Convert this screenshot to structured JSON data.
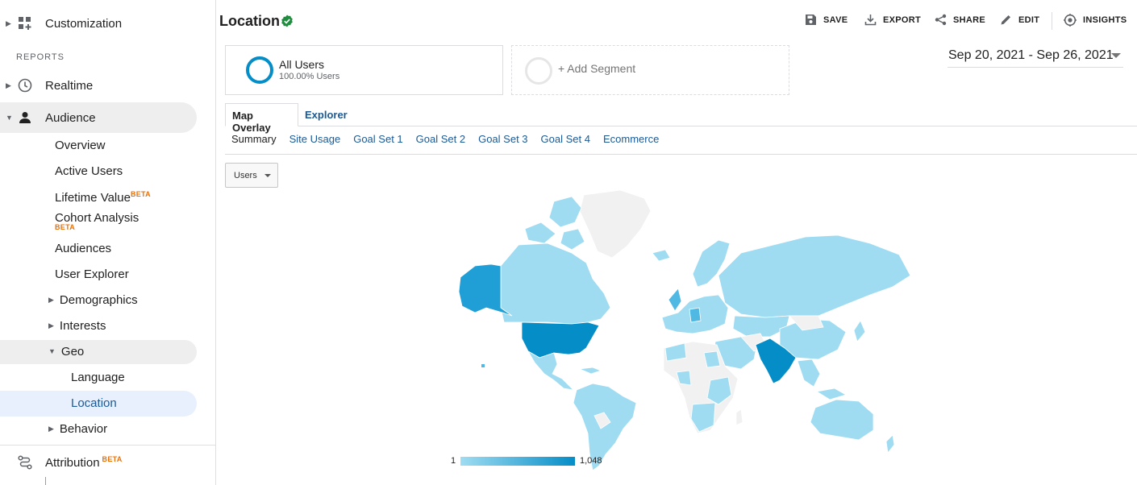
{
  "sidebar": {
    "customization": "Customization",
    "reports_header": "REPORTS",
    "realtime": "Realtime",
    "audience": "Audience",
    "audience_items": {
      "overview": "Overview",
      "active_users": "Active Users",
      "lifetime_value": "Lifetime Value",
      "cohort_analysis": "Cohort Analysis",
      "audiences": "Audiences",
      "user_explorer": "User Explorer",
      "demographics": "Demographics",
      "interests": "Interests",
      "geo": "Geo",
      "language": "Language",
      "location": "Location",
      "behavior": "Behavior"
    },
    "attribution": "Attribution",
    "beta_badge": "BETA"
  },
  "header": {
    "title": "Location",
    "actions": {
      "save": "SAVE",
      "export": "EXPORT",
      "share": "SHARE",
      "edit": "EDIT",
      "insights": "INSIGHTS"
    }
  },
  "segments": {
    "active": {
      "name": "All Users",
      "sub": "100.00% Users"
    },
    "add": "+ Add Segment"
  },
  "date_range": "Sep 20, 2021 - Sep 26, 2021",
  "tabs": {
    "map_overlay": "Map Overlay",
    "explorer": "Explorer"
  },
  "subtabs": [
    "Summary",
    "Site Usage",
    "Goal Set 1",
    "Goal Set 2",
    "Goal Set 3",
    "Goal Set 4",
    "Ecommerce"
  ],
  "metric_dropdown": "Users",
  "map": {
    "legend_min": "1",
    "legend_max": "1,048",
    "colors": {
      "low": "#9fdcf2",
      "mid": "#4fb9e3",
      "high": "#058dc7",
      "none": "#f1f1f1",
      "border": "#ffffff"
    }
  },
  "colors": {
    "accent": "#058dc7",
    "link": "#1a5a96",
    "verified": "#1e8e3e",
    "beta": "#e8710a"
  }
}
